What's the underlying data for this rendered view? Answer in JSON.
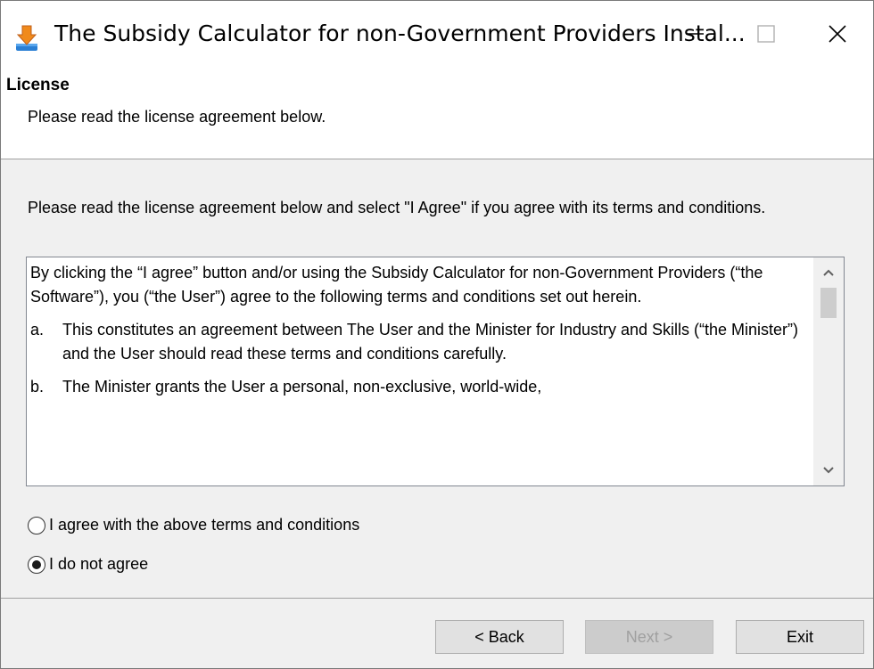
{
  "window": {
    "title": "The Subsidy Calculator for non-Government Providers Instal...",
    "icon": "installer-icon",
    "controls": {
      "minimize": "minimize-icon",
      "maximize": "maximize-icon",
      "close": "close-icon"
    }
  },
  "header": {
    "title": "License",
    "subtitle": "Please read the license agreement below."
  },
  "intro": "Please read the license agreement below and select \"I Agree\" if you agree with its terms and conditions.",
  "license": {
    "paragraphs": [
      "By clicking the “I agree” button and/or using the Subsidy Calculator for non-Government Providers (“the Software”), you (“the User”) agree to the following terms and conditions set out herein."
    ],
    "items": [
      {
        "label": "a.",
        "text": "This constitutes an agreement between The User and the Minister for Industry and Skills (“the Minister”) and the User should read these terms and conditions carefully."
      },
      {
        "label": "b.",
        "text": "The Minister grants the User a personal, non-exclusive, world-wide,"
      }
    ]
  },
  "options": {
    "agree": {
      "label": "I agree with the above terms and conditions",
      "selected": false
    },
    "disagree": {
      "label": "I do not agree",
      "selected": true
    }
  },
  "buttons": {
    "back": "< Back",
    "next": "Next >",
    "exit": "Exit"
  }
}
